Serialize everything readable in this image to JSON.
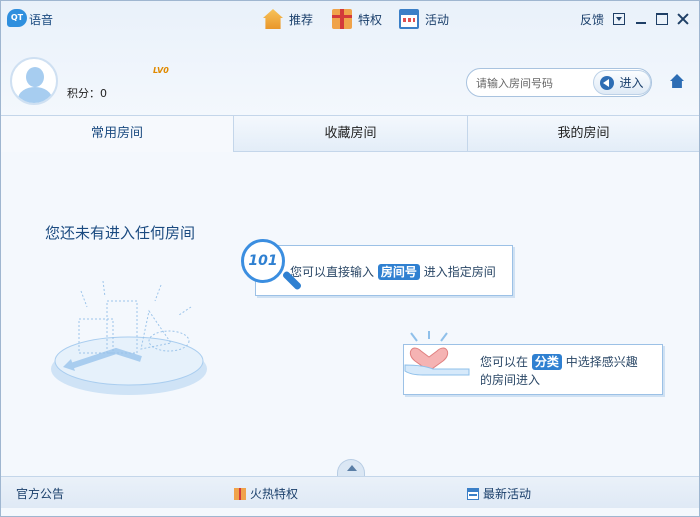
{
  "app": {
    "logo_text": "QT",
    "title": "语音"
  },
  "nav": [
    {
      "label": "推荐",
      "icon": "house-icon"
    },
    {
      "label": "特权",
      "icon": "gift-icon"
    },
    {
      "label": "活动",
      "icon": "calendar-icon"
    }
  ],
  "window": {
    "feedback_label": "反馈"
  },
  "user": {
    "level_badge": "LV0",
    "score_label": "积分：0"
  },
  "room_search": {
    "placeholder": "请输入房间号码",
    "enter_label": "进入"
  },
  "tabs": [
    {
      "label": "常用房间",
      "active": true
    },
    {
      "label": "收藏房间",
      "active": false
    },
    {
      "label": "我的房间",
      "active": false
    }
  ],
  "main": {
    "empty_message": "您还未有进入任何房间",
    "tip1": {
      "badge": "101",
      "prefix": "您可以直接输入",
      "highlight": "房间号",
      "suffix": "进入指定房间"
    },
    "tip2": {
      "prefix": "您可以在",
      "highlight": "分类",
      "suffix": "中选择感兴趣",
      "line2": "的房间进入"
    }
  },
  "footer": [
    {
      "label": "官方公告"
    },
    {
      "label": "火热特权",
      "icon": "gift-icon"
    },
    {
      "label": "最新活动",
      "icon": "calendar-icon"
    }
  ],
  "colors": {
    "accent": "#2f80d1",
    "title_blue": "#1a4a80"
  }
}
